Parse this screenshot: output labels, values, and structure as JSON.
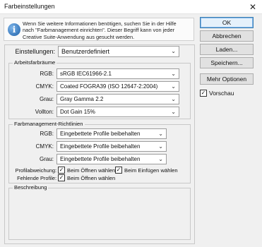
{
  "window": {
    "title": "Farbeinstellungen",
    "close_symbol": "✕"
  },
  "info": {
    "icon": "info-icon",
    "icon_glyph": "i",
    "line1": "Wenn Sie weitere Informationen benötigen, suchen Sie in der Hilfe",
    "line2": "nach \"Farbmanagement einrichten\". Dieser Begriff kann von jeder",
    "line3": "Creative Suite-Anwendung aus gesucht werden."
  },
  "buttons": {
    "ok": "OK",
    "cancel": "Abbrechen",
    "load": "Laden...",
    "save": "Speichern...",
    "more_options": "Mehr Optionen"
  },
  "preview": {
    "label": "Vorschau",
    "checked": "✓"
  },
  "settings": {
    "label": "Einstellungen:",
    "value": "Benutzerdefiniert"
  },
  "working_spaces": {
    "title": "Arbeitsfarbräume",
    "rows": [
      {
        "label": "RGB:",
        "value": "sRGB IEC61966-2.1"
      },
      {
        "label": "CMYK:",
        "value": "Coated FOGRA39 (ISO 12647-2:2004)"
      },
      {
        "label": "Grau:",
        "value": "Gray Gamma 2.2"
      },
      {
        "label": "Vollton:",
        "value": "Dot Gain 15%"
      }
    ]
  },
  "policies": {
    "title": "Farbmanagement-Richtlinien",
    "rows": [
      {
        "label": "RGB:",
        "value": "Eingebettete Profile beibehalten"
      },
      {
        "label": "CMYK:",
        "value": "Eingebettete Profile beibehalten"
      },
      {
        "label": "Grau:",
        "value": "Eingebettete Profile beibehalten"
      }
    ],
    "mismatch_label": "Profilabweichung:",
    "mismatch_open": "Beim Öffnen wählen",
    "mismatch_paste": "Beim Einfügen wählen",
    "missing_label": "Fehlende Profile:",
    "missing_open": "Beim Öffnen wählen",
    "check": "✓"
  },
  "description": {
    "title": "Beschreibung"
  },
  "chevron": "⌄"
}
